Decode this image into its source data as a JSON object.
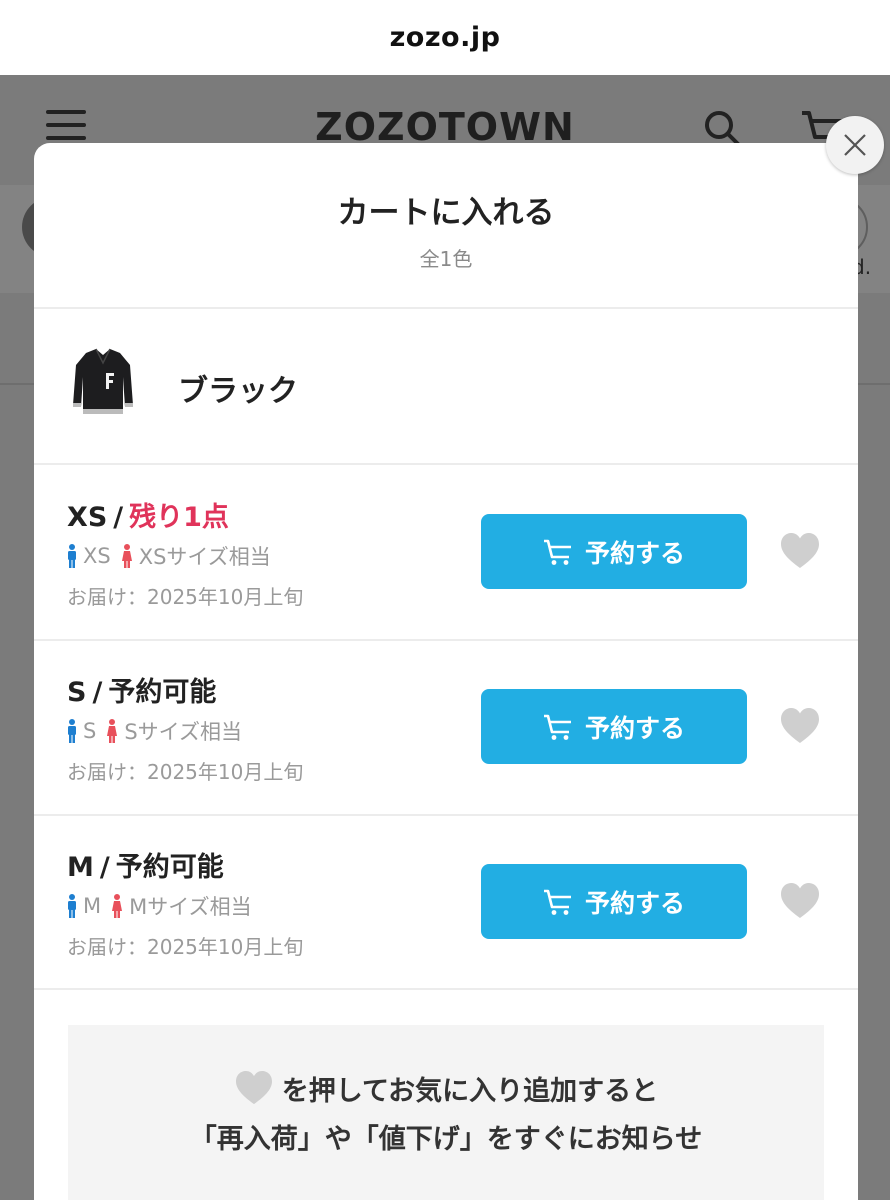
{
  "browser": {
    "url": "zozo.jp"
  },
  "header": {
    "logo": "ZOZOTOWN",
    "side_text": "d."
  },
  "modal": {
    "title": "カートに入れる",
    "subtitle": "全1色",
    "color": {
      "name": "ブラック"
    },
    "sizes": [
      {
        "size": "XS",
        "status": "残り1点",
        "status_type": "warning",
        "mens": "XS",
        "womens": "XSサイズ相当",
        "delivery": "お届け：2025年10月上旬",
        "button_label": "予約する"
      },
      {
        "size": "S",
        "status": "予約可能",
        "status_type": "normal",
        "mens": "S",
        "womens": "Sサイズ相当",
        "delivery": "お届け：2025年10月上旬",
        "button_label": "予約する"
      },
      {
        "size": "M",
        "status": "予約可能",
        "status_type": "normal",
        "mens": "M",
        "womens": "Mサイズ相当",
        "delivery": "お届け：2025年10月上旬",
        "button_label": "予約する"
      }
    ],
    "info": {
      "line1": "を押してお気に入り追加すると",
      "line2": "「再入荷」や「値下げ」をすぐにお知らせ"
    }
  },
  "colors": {
    "accent": "#22aee3",
    "warning": "#e0335a",
    "male": "#1e7fd0",
    "female": "#e8505b",
    "heart": "#cfcfcf"
  },
  "icons": [
    "menu-icon",
    "search-icon",
    "cart-icon",
    "close-icon",
    "cart-icon-white",
    "heart-icon",
    "male-icon",
    "female-icon"
  ]
}
